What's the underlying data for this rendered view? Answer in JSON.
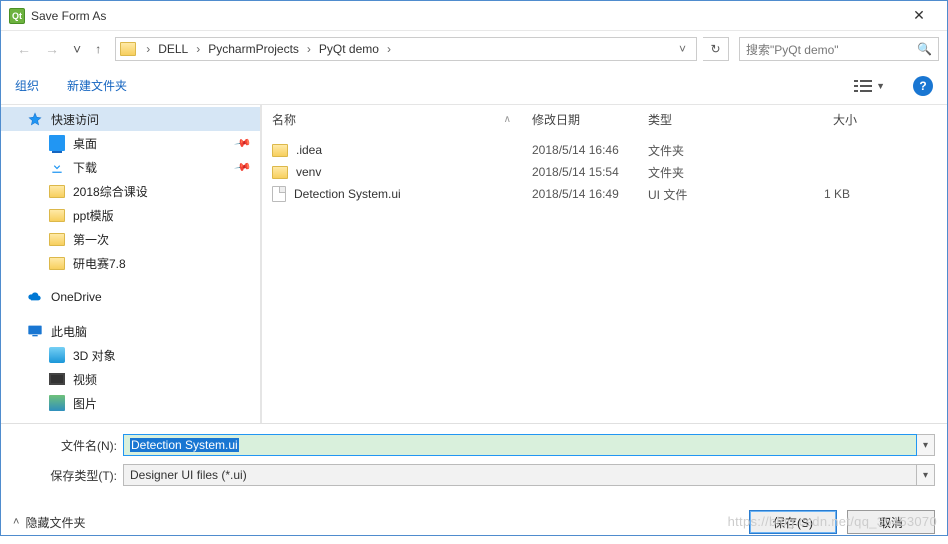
{
  "titlebar": {
    "title": "Save Form As",
    "close": "✕",
    "app_icon_label": "Qt"
  },
  "nav": {
    "breadcrumb": [
      "DELL",
      "PycharmProjects",
      "PyQt demo"
    ],
    "search_placeholder": "搜索\"PyQt demo\""
  },
  "toolbar": {
    "organize": "组织",
    "new_folder": "新建文件夹",
    "help": "?"
  },
  "sidebar": {
    "quick_access": "快速访问",
    "items": [
      {
        "label": "桌面",
        "pinned": true
      },
      {
        "label": "下载",
        "pinned": true
      },
      {
        "label": "2018综合课设",
        "pinned": false
      },
      {
        "label": "ppt模版",
        "pinned": false
      },
      {
        "label": "第一次",
        "pinned": false
      },
      {
        "label": "研电赛7.8",
        "pinned": false
      }
    ],
    "onedrive": "OneDrive",
    "this_pc": "此电脑",
    "this_pc_items": [
      {
        "label": "3D 对象"
      },
      {
        "label": "视频"
      },
      {
        "label": "图片"
      }
    ]
  },
  "columns": {
    "name": "名称",
    "date": "修改日期",
    "type": "类型",
    "size": "大小"
  },
  "files": [
    {
      "name": ".idea",
      "date": "2018/5/14 16:46",
      "type": "文件夹",
      "size": "",
      "kind": "folder"
    },
    {
      "name": "venv",
      "date": "2018/5/14 15:54",
      "type": "文件夹",
      "size": "",
      "kind": "folder"
    },
    {
      "name": "Detection System.ui",
      "date": "2018/5/14 16:49",
      "type": "UI 文件",
      "size": "1 KB",
      "kind": "file"
    }
  ],
  "form": {
    "filename_label": "文件名(N):",
    "filename_value": "Detection System.ui",
    "filetype_label": "保存类型(T):",
    "filetype_value": "Designer UI files (*.ui)"
  },
  "footer": {
    "hide_folders": "隐藏文件夹",
    "save": "保存(S)",
    "cancel": "取消"
  },
  "watermark": "https://blog.csdn.net/qq_35453070"
}
